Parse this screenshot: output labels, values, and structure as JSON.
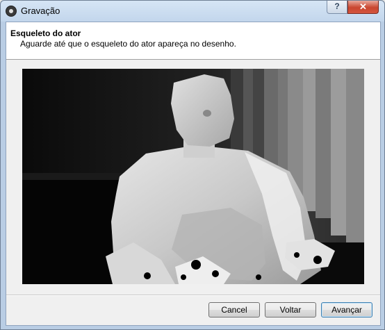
{
  "window": {
    "title": "Gravação",
    "help_glyph": "?",
    "close_glyph": "✕",
    "app_icon": "app-icon"
  },
  "header": {
    "title": "Esqueleto do ator",
    "subtitle": "Aguarde até que o esqueleto do ator apareça no desenho."
  },
  "preview": {
    "kind": "depth-camera-image"
  },
  "buttons": {
    "cancel": "Cancel",
    "back": "Voltar",
    "next": "Avançar"
  },
  "colors": {
    "titlebar": "#c2d6ec",
    "close_button": "#c94630",
    "default_button_border": "#3c7fb1"
  }
}
